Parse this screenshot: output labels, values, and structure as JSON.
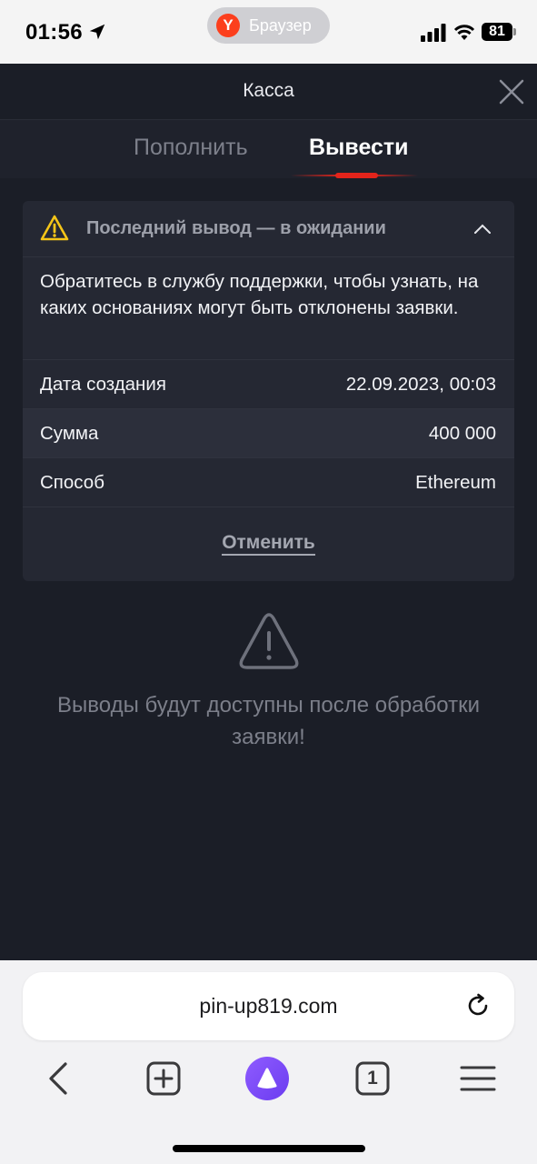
{
  "status_bar": {
    "time": "01:56",
    "browser_pill_logo": "Y",
    "browser_pill_label": "Браузер",
    "battery": "81"
  },
  "header": {
    "title": "Касса"
  },
  "tabs": [
    {
      "label": "Пополнить",
      "active": false
    },
    {
      "label": "Вывести",
      "active": true
    }
  ],
  "withdrawal_card": {
    "status_title": "Последний вывод — в ожидании",
    "notice": "Обратитесь в службу поддержки, чтобы узнать, на каких основаниях могут быть отклонены заявки.",
    "rows": [
      {
        "label": "Дата создания",
        "value": "22.09.2023, 00:03"
      },
      {
        "label": "Сумма",
        "value": "400 000"
      },
      {
        "label": "Способ",
        "value": "Ethereum"
      }
    ],
    "cancel_label": "Отменить"
  },
  "empty_state": {
    "message": "Выводы будут доступны после обработки заявки!"
  },
  "browser": {
    "url": "pin-up819.com",
    "tab_count": "1"
  },
  "colors": {
    "background": "#1b1e27",
    "card": "#252833",
    "accent_red": "#e3241b",
    "warning_yellow": "#f5c518",
    "alice_purple": "#7b45f5"
  }
}
